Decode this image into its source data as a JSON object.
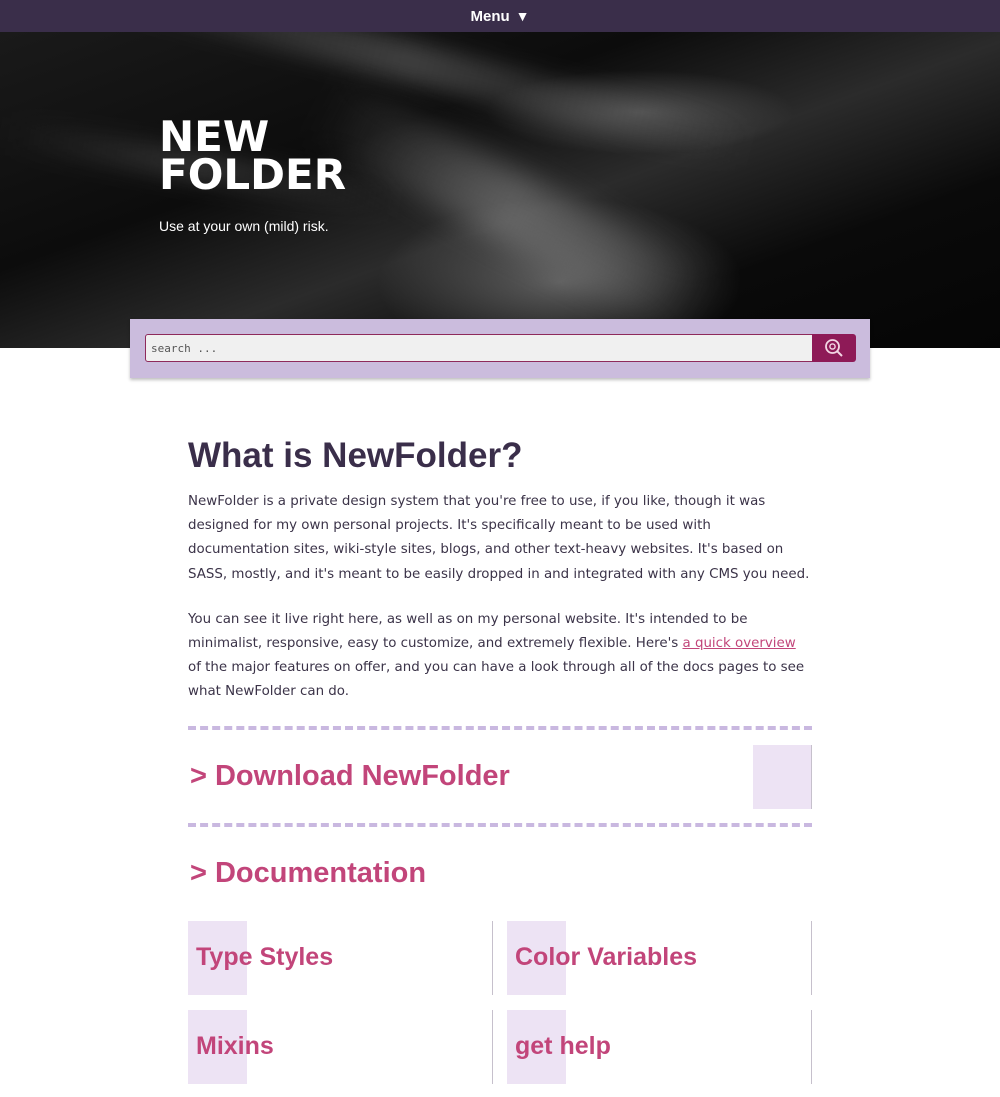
{
  "topbar": {
    "menu_label": "Menu",
    "menu_icon": "triangle-down-icon"
  },
  "hero": {
    "brand_line1": "NEW",
    "brand_line2": "FOLDER",
    "tagline": "Use at your own (mild) risk."
  },
  "search": {
    "placeholder": "search ...",
    "button_icon": "search-icon"
  },
  "main": {
    "title": "What is NewFolder?",
    "paragraph1": "NewFolder is a private design system that you're free to use, if you like, though it was designed for my own personal projects. It's specifically meant to be used with documentation sites, wiki-style sites, blogs, and other text-heavy websites. It's based on SASS, mostly, and it's meant to be easily dropped in and integrated with any CMS you need.",
    "paragraph2_before": "You can see it live right here, as well as on my personal website. It's intended to be minimalist, responsive, easy to customize, and extremely flexible. Here's ",
    "paragraph2_link": "a quick overview",
    "paragraph2_after": " of the major features on offer, and you can have a look through all of the docs pages to see what NewFolder can do.",
    "download_link": "> Download NewFolder",
    "documentation_heading": "> Documentation",
    "docs": [
      {
        "label": "Type Styles"
      },
      {
        "label": "Color Variables"
      },
      {
        "label": "Mixins"
      },
      {
        "label": "get help"
      }
    ]
  },
  "colors": {
    "topbar": "#3a2e4a",
    "accent": "#c2457a",
    "search_panel": "#cbbcdd",
    "search_button": "#8e1a57",
    "tile": "#ede3f4"
  }
}
